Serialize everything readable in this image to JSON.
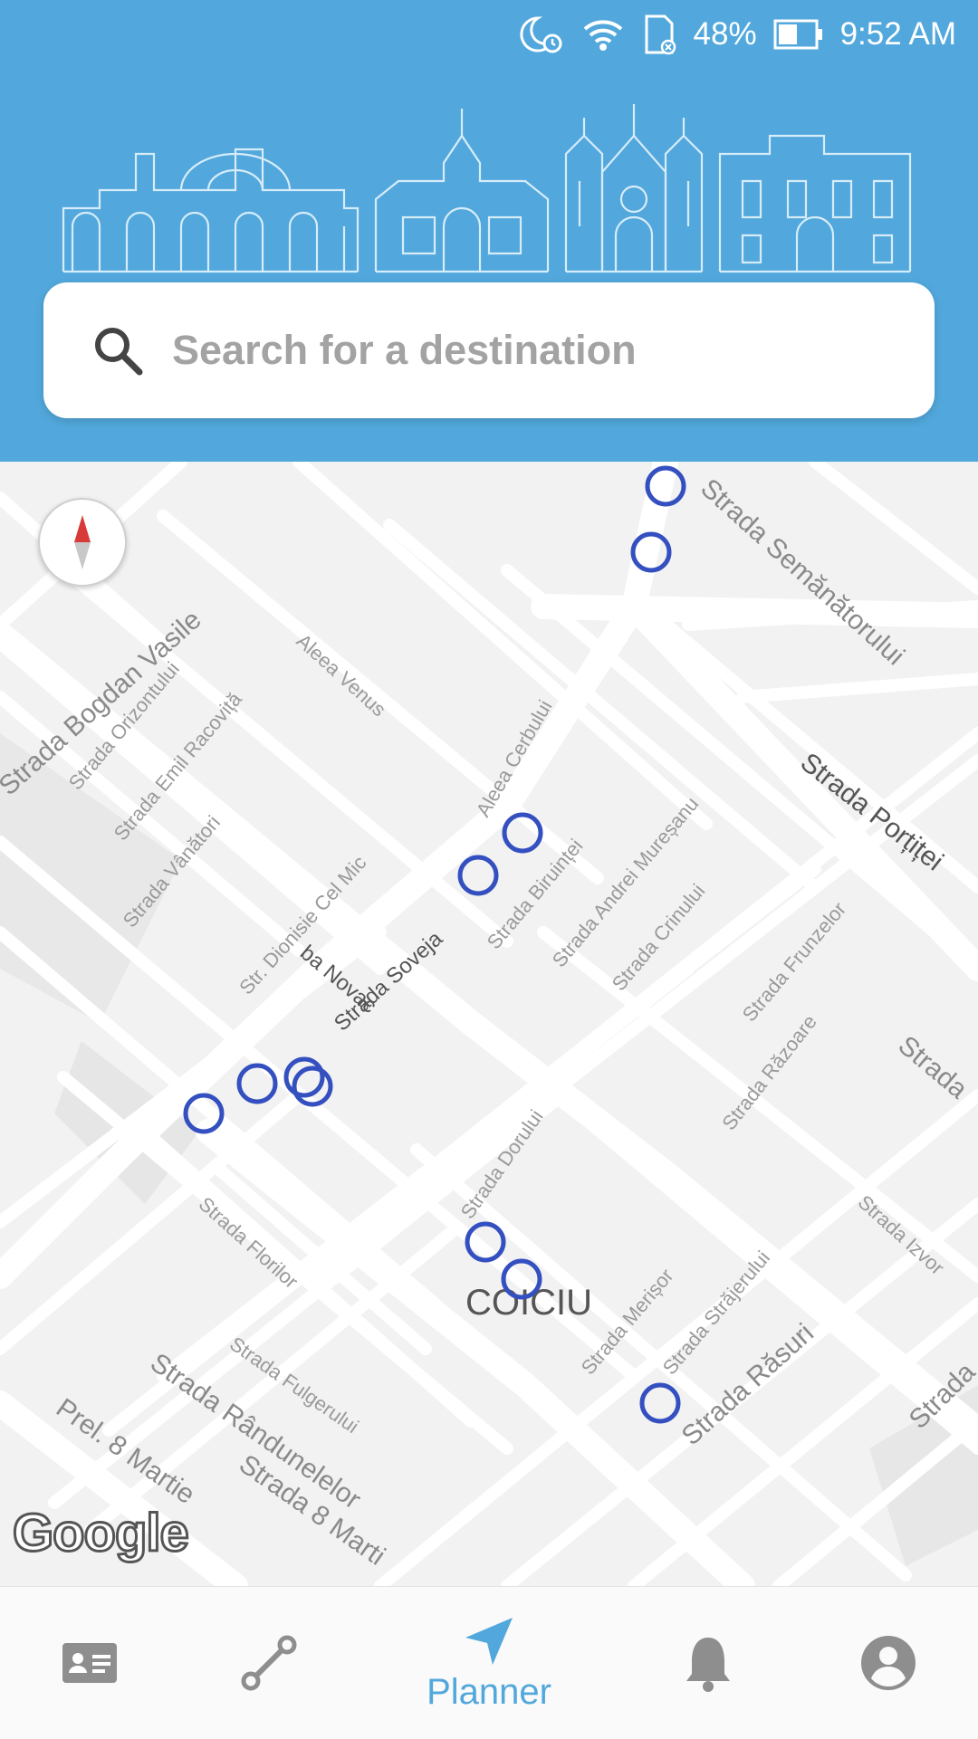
{
  "status_bar": {
    "battery": "48%",
    "time": "9:52 AM",
    "icons": [
      "moon-alarm-icon",
      "wifi-icon",
      "sd-card-icon",
      "battery-icon"
    ]
  },
  "search": {
    "placeholder": "Search for a destination",
    "value": ""
  },
  "map": {
    "district": "COICIU",
    "attribution": "Google",
    "streets": [
      "Strada Semănătorului",
      "Strada Bogdan Vasile",
      "Strada Orizontului",
      "Strada Emil Racoviță",
      "Aleea Venus",
      "Strada Vânători",
      "Aleea Cerbului",
      "Str. Dionisie Cel Mic",
      "Strada Biruinței",
      "Strada Andrei Mureșanu",
      "Strada Porțiței",
      "Strada Crinului",
      "Strada Soveja",
      "Strada Frunzelor",
      "Strada Răzoare",
      "Strada",
      "ba Novac",
      "Strada Dorului",
      "Strada Florilor",
      "Strada Izvor",
      "Strada Merișor",
      "Strada Străjerului",
      "Strada Răsuri",
      "Strada Fulgerului",
      "Strada Rândunelelor",
      "Prel. 8 Martie",
      "Strada 8 Marti",
      "Strada"
    ]
  },
  "nav": {
    "items": [
      {
        "icon": "id-card-icon",
        "label": ""
      },
      {
        "icon": "route-icon",
        "label": ""
      },
      {
        "icon": "send-icon",
        "label": "Planner"
      },
      {
        "icon": "bell-icon",
        "label": ""
      },
      {
        "icon": "account-icon",
        "label": ""
      }
    ]
  },
  "colors": {
    "header": "#52a8dc",
    "accent": "#52a8dc",
    "marker": "#3450c0",
    "compass_needle": "#d83a3a"
  }
}
